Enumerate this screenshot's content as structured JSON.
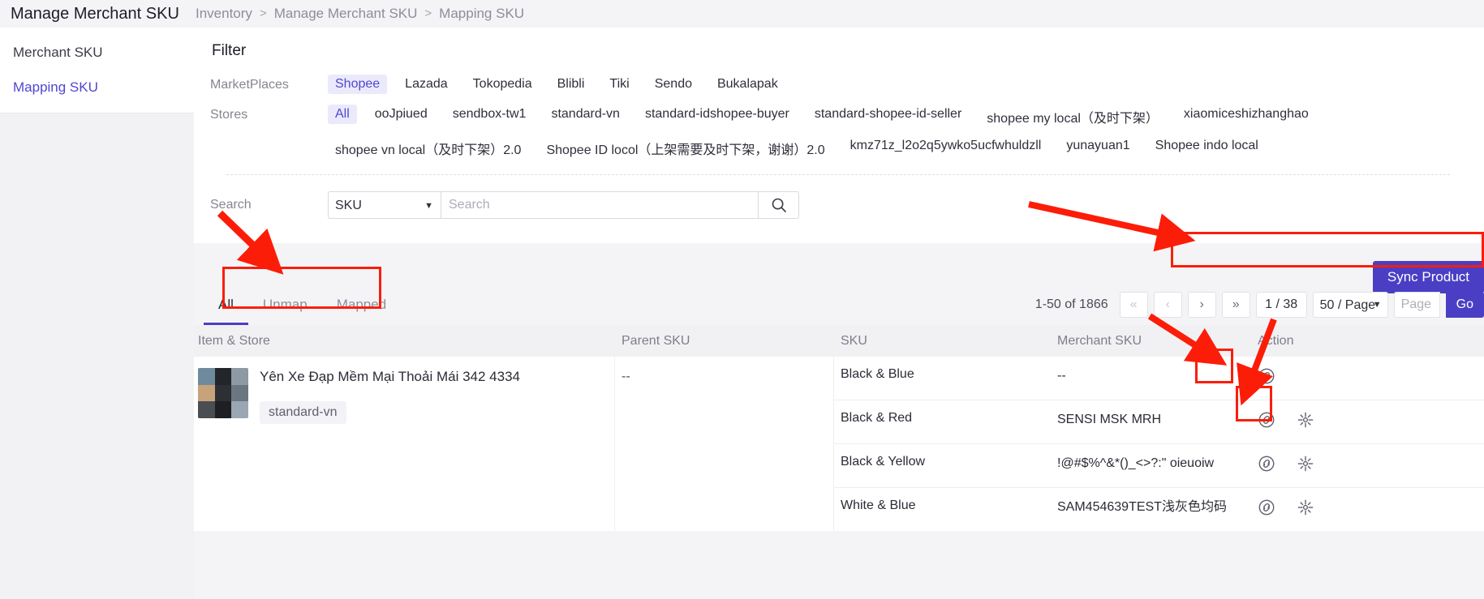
{
  "sidebar": {
    "title": "Manage Merchant SKU",
    "items": [
      {
        "label": "Merchant SKU",
        "active": false
      },
      {
        "label": "Mapping SKU",
        "active": true
      }
    ]
  },
  "breadcrumb": {
    "items": [
      "Inventory",
      "Manage Merchant SKU",
      "Mapping SKU"
    ],
    "separator": ">"
  },
  "filter": {
    "title": "Filter",
    "marketplaces_label": "MarketPlaces",
    "marketplaces": [
      {
        "label": "Shopee",
        "selected": true
      },
      {
        "label": "Lazada",
        "selected": false
      },
      {
        "label": "Tokopedia",
        "selected": false
      },
      {
        "label": "Blibli",
        "selected": false
      },
      {
        "label": "Tiki",
        "selected": false
      },
      {
        "label": "Sendo",
        "selected": false
      },
      {
        "label": "Bukalapak",
        "selected": false
      }
    ],
    "stores_label": "Stores",
    "stores": [
      {
        "label": "All",
        "selected": true
      },
      {
        "label": "ooJpiued",
        "selected": false
      },
      {
        "label": "sendbox-tw1",
        "selected": false
      },
      {
        "label": "standard-vn",
        "selected": false
      },
      {
        "label": "standard-idshopee-buyer",
        "selected": false
      },
      {
        "label": "standard-shopee-id-seller",
        "selected": false
      },
      {
        "label": "shopee my local（及时下架）",
        "selected": false
      },
      {
        "label": "xiaomiceshizhanghao",
        "selected": false
      },
      {
        "label": "shopee vn local（及时下架）2.0",
        "selected": false
      },
      {
        "label": "Shopee ID locol（上架需要及时下架，谢谢）2.0",
        "selected": false
      },
      {
        "label": "kmz71z_l2o2q5ywko5ucfwhuldzll",
        "selected": false
      },
      {
        "label": "yunayuan1",
        "selected": false
      },
      {
        "label": "Shopee indo local",
        "selected": false
      }
    ],
    "search_label": "Search",
    "search_type_value": "SKU",
    "search_type_options": [
      "SKU"
    ],
    "search_placeholder": "Search",
    "search_value": ""
  },
  "toolbar": {
    "sync_label": "Sync Product",
    "tabs": [
      {
        "label": "All",
        "active": true
      },
      {
        "label": "Unmap",
        "active": false
      },
      {
        "label": "Mapped",
        "active": false
      }
    ]
  },
  "pagination": {
    "count_text": "1-50 of 1866",
    "first_icon": "«",
    "prev_icon": "‹",
    "next_icon": "›",
    "last_icon": "»",
    "page_indicator": "1 / 38",
    "page_size_value": "50 / Page",
    "page_size_options": [
      "50 / Page"
    ],
    "page_input_placeholder": "Page",
    "page_input_value": "",
    "go_label": "Go"
  },
  "table": {
    "columns": [
      "Item & Store",
      "Parent SKU",
      "SKU",
      "Merchant SKU",
      "Action"
    ],
    "row": {
      "item_name": "Yên Xe Đạp Mềm Mại Thoải Mái 342 4334",
      "store_tag": "standard-vn",
      "parent_sku": "--",
      "variants": [
        {
          "sku": "Black & Blue",
          "merchant_sku": "--"
        },
        {
          "sku": "Black & Red",
          "merchant_sku": "SENSI MSK MRH"
        },
        {
          "sku": "Black & Yellow",
          "merchant_sku": "!@#$%^&*()_<>?:\" oieuoiw"
        },
        {
          "sku": "White & Blue",
          "merchant_sku": "SAM454639TEST浅灰色均码"
        }
      ],
      "action_link_icon": "link-icon",
      "action_split_icon": "split-icon"
    }
  },
  "colors": {
    "accent": "#4a3fc4",
    "chip_selected_bg": "#ebeafc",
    "annotation": "#fc1d08"
  }
}
